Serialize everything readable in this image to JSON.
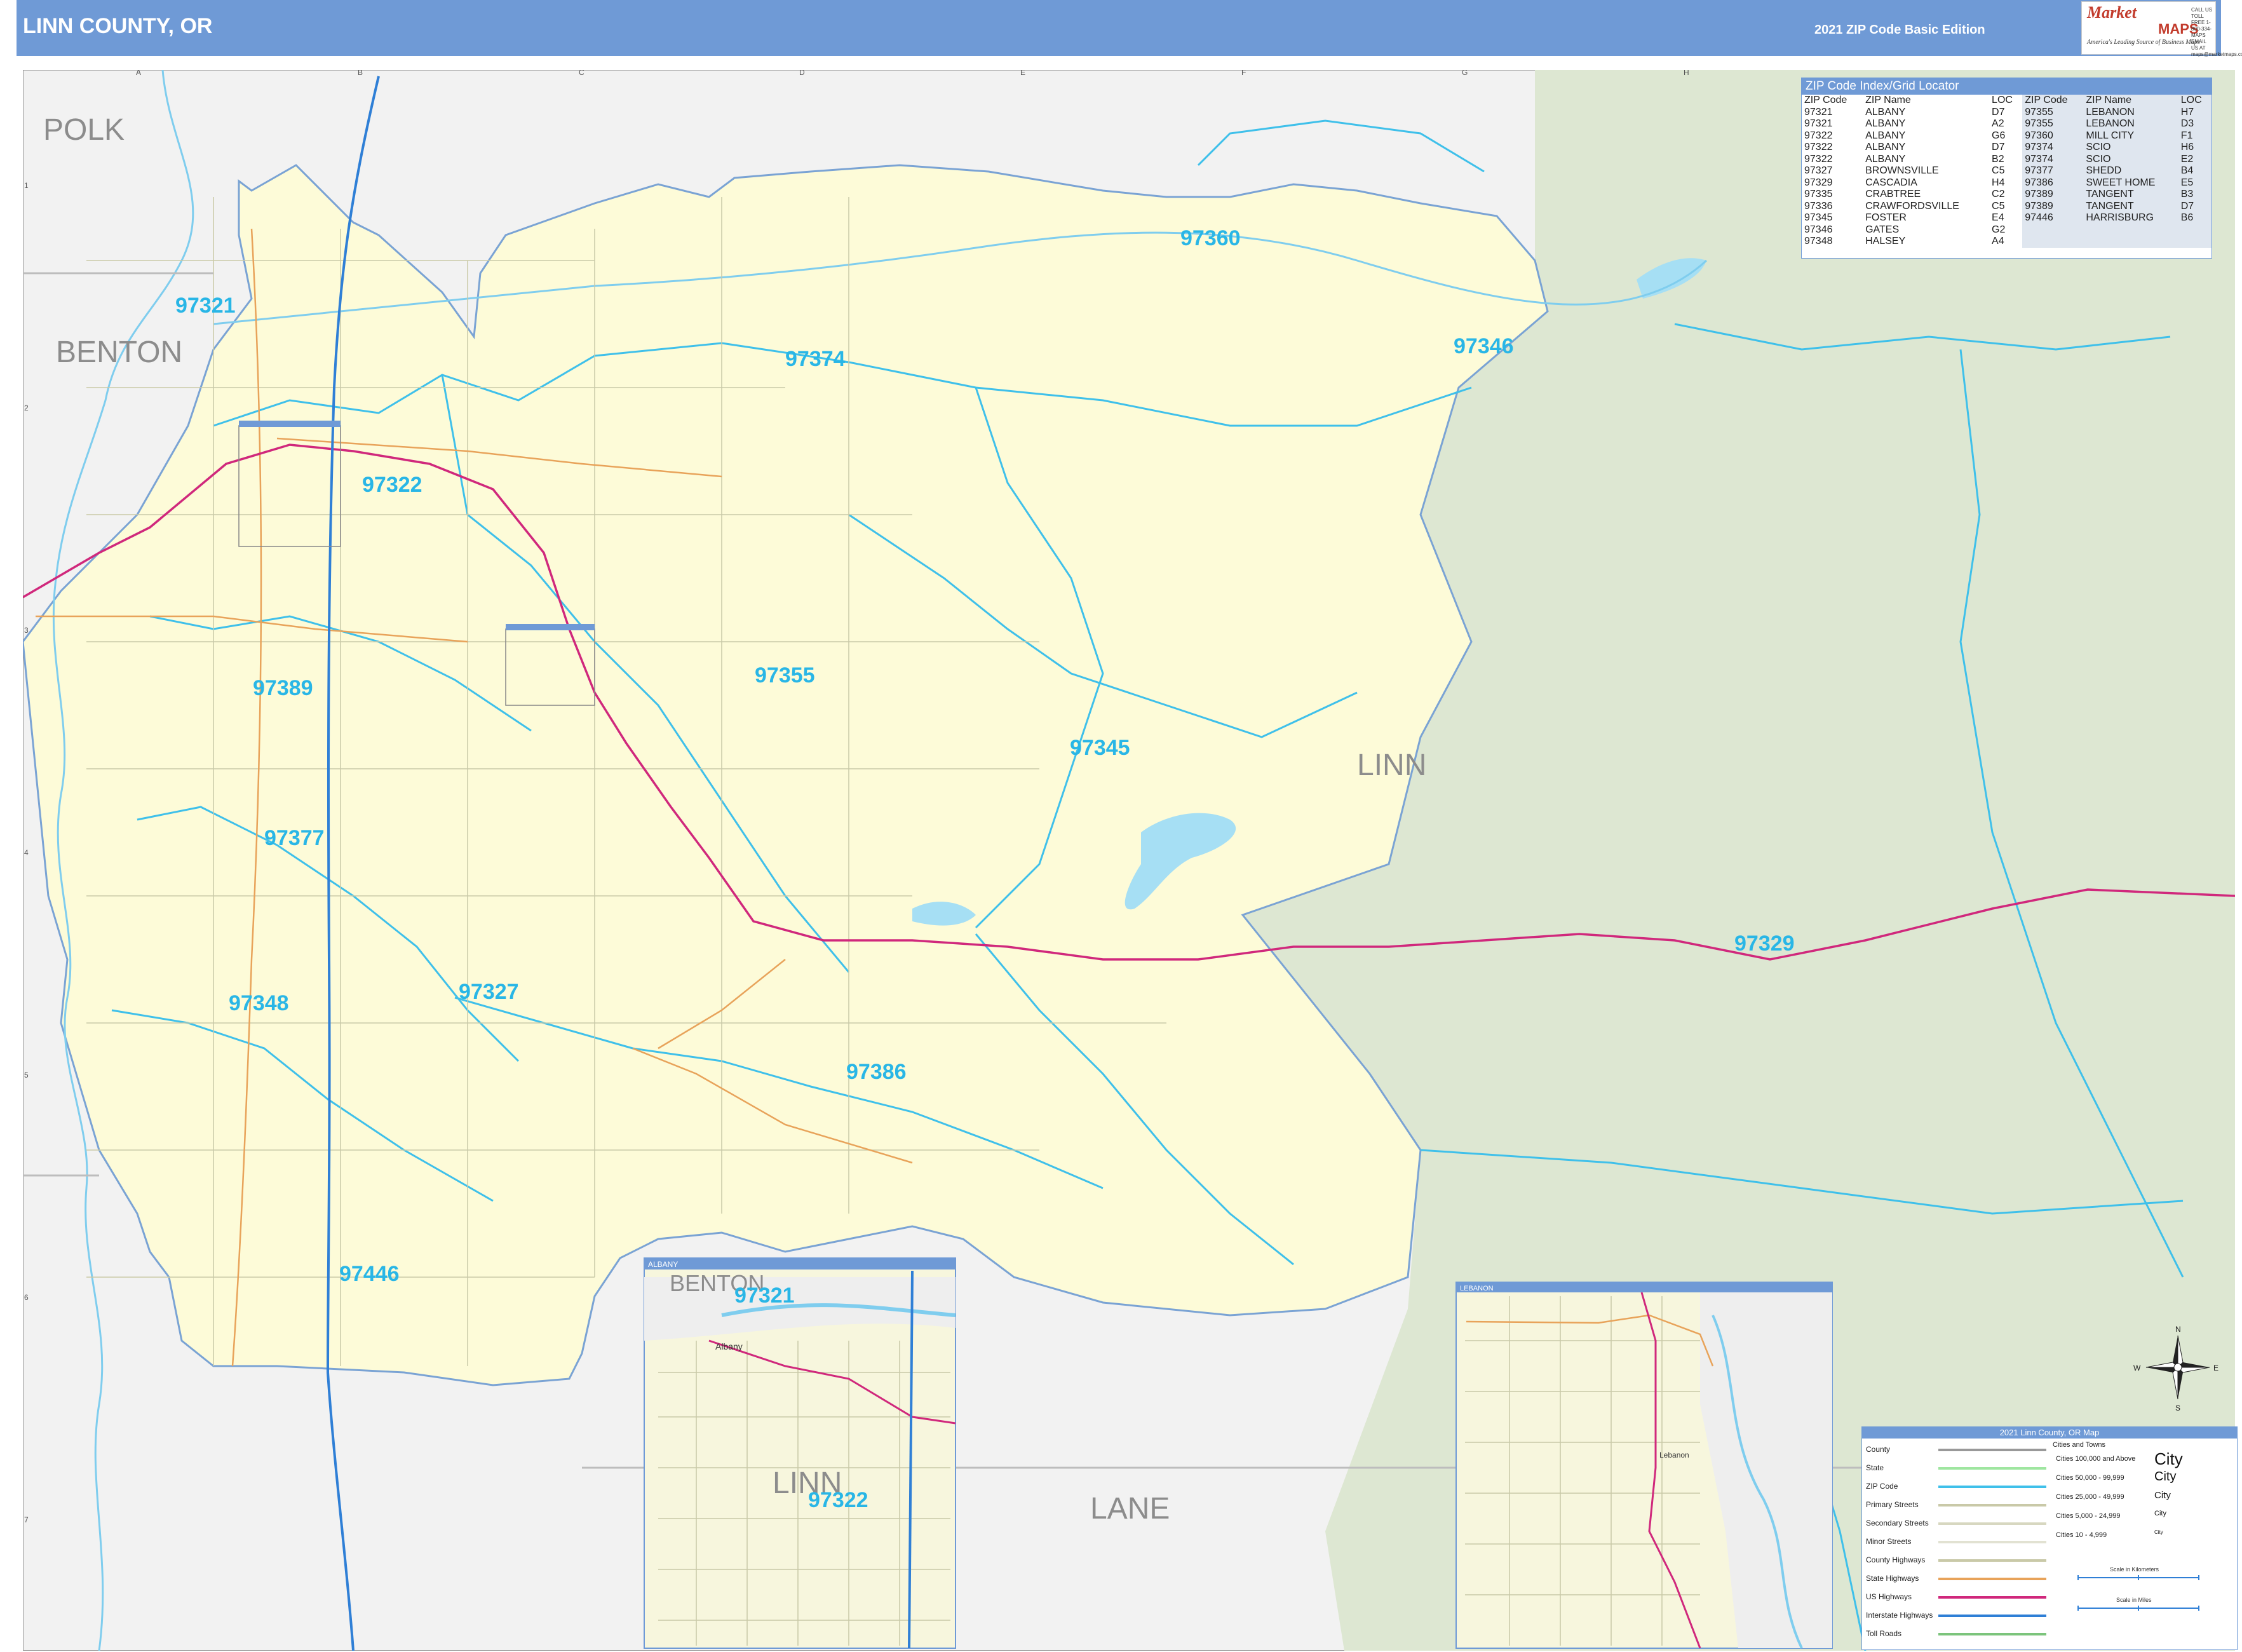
{
  "header": {
    "title": "LINN COUNTY, OR",
    "edition": "2021 ZIP Code Basic Edition",
    "logo": {
      "line1": "Market",
      "line2": "MAPS",
      "tagline": "America's Leading Source of Business Maps",
      "contact": "CALL US TOLL FREE 1-800-334-MAPS EMAIL US AT maps@marketmaps.com"
    }
  },
  "colors": {
    "header": "#6f9ad6",
    "county_fill": "#fdfbd8",
    "forest": "#dfe8d4",
    "zip_label": "#29b6e6",
    "zip_boundary": "#3fc0ea",
    "us_highway": "#d0287c",
    "interstate": "#2f7fd6",
    "water": "#a6dff4",
    "outside": "#f0f0f0"
  },
  "region_labels": [
    "POLK",
    "BENTON",
    "LINN",
    "LANE"
  ],
  "grid": {
    "columns": [
      "A",
      "B",
      "C",
      "D",
      "E",
      "F",
      "G",
      "H"
    ],
    "rows": [
      "1",
      "2",
      "3",
      "4",
      "5",
      "6",
      "7"
    ]
  },
  "zip_labels": [
    "97321",
    "97322",
    "97360",
    "97346",
    "97374",
    "97355",
    "97389",
    "97345",
    "97377",
    "97329",
    "97327",
    "97348",
    "97386",
    "97446"
  ],
  "zip_index": {
    "title": "ZIP Code Index/Grid Locator",
    "headers": [
      "ZIP Code",
      "ZIP Name",
      "LOC",
      "ZIP Code",
      "ZIP Name",
      "LOC"
    ],
    "left": [
      [
        "97321",
        "ALBANY",
        "D7"
      ],
      [
        "97321",
        "ALBANY",
        "A2"
      ],
      [
        "97322",
        "ALBANY",
        "G6"
      ],
      [
        "97322",
        "ALBANY",
        "D7"
      ],
      [
        "97322",
        "ALBANY",
        "B2"
      ],
      [
        "97327",
        "BROWNSVILLE",
        "C5"
      ],
      [
        "97329",
        "CASCADIA",
        "H4"
      ],
      [
        "97335",
        "CRABTREE",
        "C2"
      ],
      [
        "97336",
        "CRAWFORDSVILLE",
        "C5"
      ],
      [
        "97345",
        "FOSTER",
        "E4"
      ],
      [
        "97346",
        "GATES",
        "G2"
      ],
      [
        "97348",
        "HALSEY",
        "A4"
      ]
    ],
    "right": [
      [
        "97355",
        "LEBANON",
        "H7"
      ],
      [
        "97355",
        "LEBANON",
        "D3"
      ],
      [
        "97360",
        "MILL CITY",
        "F1"
      ],
      [
        "97374",
        "SCIO",
        "H6"
      ],
      [
        "97374",
        "SCIO",
        "E2"
      ],
      [
        "97377",
        "SHEDD",
        "B4"
      ],
      [
        "97386",
        "SWEET HOME",
        "E5"
      ],
      [
        "97389",
        "TANGENT",
        "B3"
      ],
      [
        "97389",
        "TANGENT",
        "D7"
      ],
      [
        "97446",
        "HARRISBURG",
        "B6"
      ]
    ]
  },
  "insets": {
    "albany": {
      "title": "ALBANY",
      "labels": [
        "BENTON",
        "97321",
        "LINN",
        "97322"
      ],
      "city": "Albany"
    },
    "lebanon": {
      "title": "LEBANON",
      "city": "Lebanon"
    }
  },
  "legend": {
    "title": "2021 Linn County, OR Map",
    "items": [
      "County",
      "State",
      "ZIP Code",
      "Primary Streets",
      "Secondary Streets",
      "Minor Streets",
      "County Highways",
      "State Highways",
      "US Highways",
      "Interstate Highways",
      "Toll Roads"
    ],
    "cities_title": "Cities and Towns",
    "cities": [
      {
        "label": "Cities 100,000 and Above",
        "sample": "City"
      },
      {
        "label": "Cities 50,000 - 99,999",
        "sample": "City"
      },
      {
        "label": "Cities 25,000 - 49,999",
        "sample": "City"
      },
      {
        "label": "Cities 5,000 - 24,999",
        "sample": "City"
      },
      {
        "label": "Cities 10 - 4,999",
        "sample": "City"
      }
    ],
    "scale_km": "Scale in Kilometers",
    "scale_mi": "Scale in Miles"
  },
  "compass": {
    "n": "N",
    "s": "S",
    "e": "E",
    "w": "W"
  }
}
